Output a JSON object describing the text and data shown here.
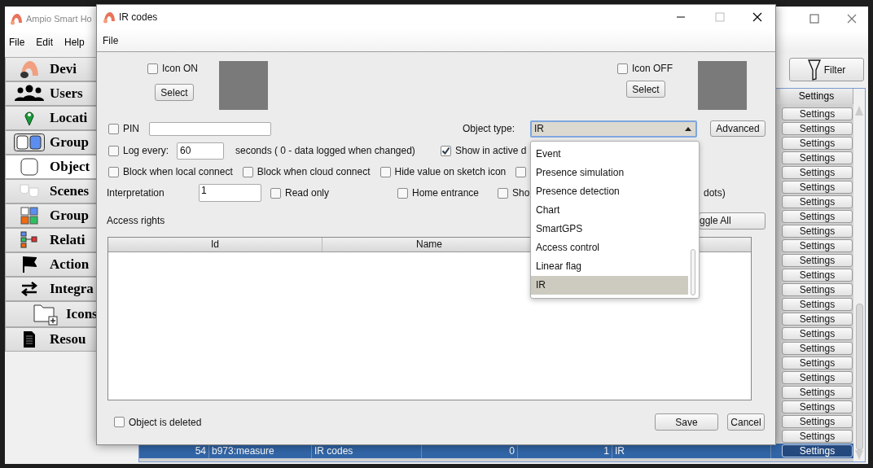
{
  "main_window": {
    "title": "Ampio Smart Ho",
    "menu": [
      "File",
      "Edit",
      "Help"
    ],
    "sidebar": [
      {
        "label": "Devi",
        "kind": "logo",
        "selected": false
      },
      {
        "label": "Users",
        "kind": "users",
        "selected": false
      },
      {
        "label": "Locati",
        "kind": "pin",
        "selected": false
      },
      {
        "label": "Group",
        "kind": "toggles",
        "selected": false
      },
      {
        "label": "Object",
        "kind": "square",
        "selected": true
      },
      {
        "label": "Scenes",
        "kind": "masks",
        "selected": false
      },
      {
        "label": "Group",
        "kind": "grid",
        "selected": false
      },
      {
        "label": "Relati",
        "kind": "relation",
        "selected": false
      },
      {
        "label": "Action",
        "kind": "flag",
        "selected": false
      },
      {
        "label": "Integra",
        "kind": "arrows",
        "selected": false
      },
      {
        "label": "Icons",
        "kind": "folder",
        "selected": false
      },
      {
        "label": "Resou",
        "kind": "document",
        "selected": false
      }
    ],
    "filter_button": "Filter",
    "table": {
      "settings_header": "Settings",
      "rows": [
        {
          "settings": "Settings",
          "selected": false
        },
        {
          "settings": "Settings",
          "selected": false
        },
        {
          "settings": "Settings",
          "selected": false
        },
        {
          "settings": "Settings",
          "selected": false
        },
        {
          "settings": "Settings",
          "selected": false
        },
        {
          "settings": "Settings",
          "selected": false
        },
        {
          "settings": "Settings",
          "selected": false
        },
        {
          "settings": "Settings",
          "selected": false
        },
        {
          "settings": "Settings",
          "selected": false
        },
        {
          "settings": "Settings",
          "selected": false
        },
        {
          "settings": "Settings",
          "selected": false
        },
        {
          "settings": "Settings",
          "selected": false
        },
        {
          "settings": "Settings",
          "selected": false
        },
        {
          "settings": "Settings",
          "selected": false
        },
        {
          "settings": "Settings",
          "selected": false
        },
        {
          "settings": "Settings",
          "selected": false
        },
        {
          "settings": "Settings",
          "selected": false
        },
        {
          "settings": "Settings",
          "selected": false
        },
        {
          "settings": "Settings",
          "selected": false
        },
        {
          "settings": "Settings",
          "selected": false
        },
        {
          "settings": "Settings",
          "selected": false
        },
        {
          "settings": "Settings",
          "selected": false
        },
        {
          "settings": "Settings",
          "selected": false
        },
        {
          "cells": [
            "54",
            "b973:measure",
            "IR codes",
            "0",
            "1",
            "IR"
          ],
          "settings": "Settings",
          "selected": true
        }
      ]
    }
  },
  "dialog": {
    "title": "IR codes",
    "menu": [
      "File"
    ],
    "icon_on": {
      "label": "Icon ON",
      "checked": false,
      "button": "Select"
    },
    "icon_off": {
      "label": "Icon OFF",
      "checked": false,
      "button": "Select"
    },
    "pin": {
      "label": "PIN",
      "checked": false
    },
    "object_type": {
      "label": "Object type:",
      "value": "IR",
      "expanded": true
    },
    "advanced_button": "Advanced",
    "log": {
      "label": "Log every:",
      "checked": false,
      "value": "60",
      "note": "seconds ( 0 - data logged when changed)"
    },
    "show_active": {
      "label": "Show in active d",
      "checked": true
    },
    "options_row": [
      {
        "label": "Block when local connect",
        "checked": false
      },
      {
        "label": "Block when cloud connect",
        "checked": false
      },
      {
        "label": "Hide value on sketch icon",
        "checked": false
      },
      {
        "checked": false
      }
    ],
    "interpretation": {
      "label": "Interpretation",
      "value": "1"
    },
    "options_row_2": [
      {
        "label": "Read only",
        "checked": false
      },
      {
        "label": "Home entrance",
        "checked": false
      },
      {
        "label": "Sho",
        "checked": false
      }
    ],
    "dots_note": "dots)",
    "access_rights": {
      "label": "Access rights",
      "toggle_button": "ggle All",
      "columns": [
        "Id",
        "Name"
      ]
    },
    "deleted": {
      "label": "Object is deleted",
      "checked": false
    },
    "buttons": [
      "Save",
      "Cancel"
    ],
    "dropdown": [
      {
        "label": "Event",
        "selected": false
      },
      {
        "label": "Presence simulation",
        "selected": false
      },
      {
        "label": "Presence detection",
        "selected": false
      },
      {
        "label": "Chart",
        "selected": false
      },
      {
        "label": "SmartGPS",
        "selected": false
      },
      {
        "label": "Access control",
        "selected": false
      },
      {
        "label": "Linear flag",
        "selected": false
      },
      {
        "label": "IR",
        "selected": true
      }
    ]
  }
}
